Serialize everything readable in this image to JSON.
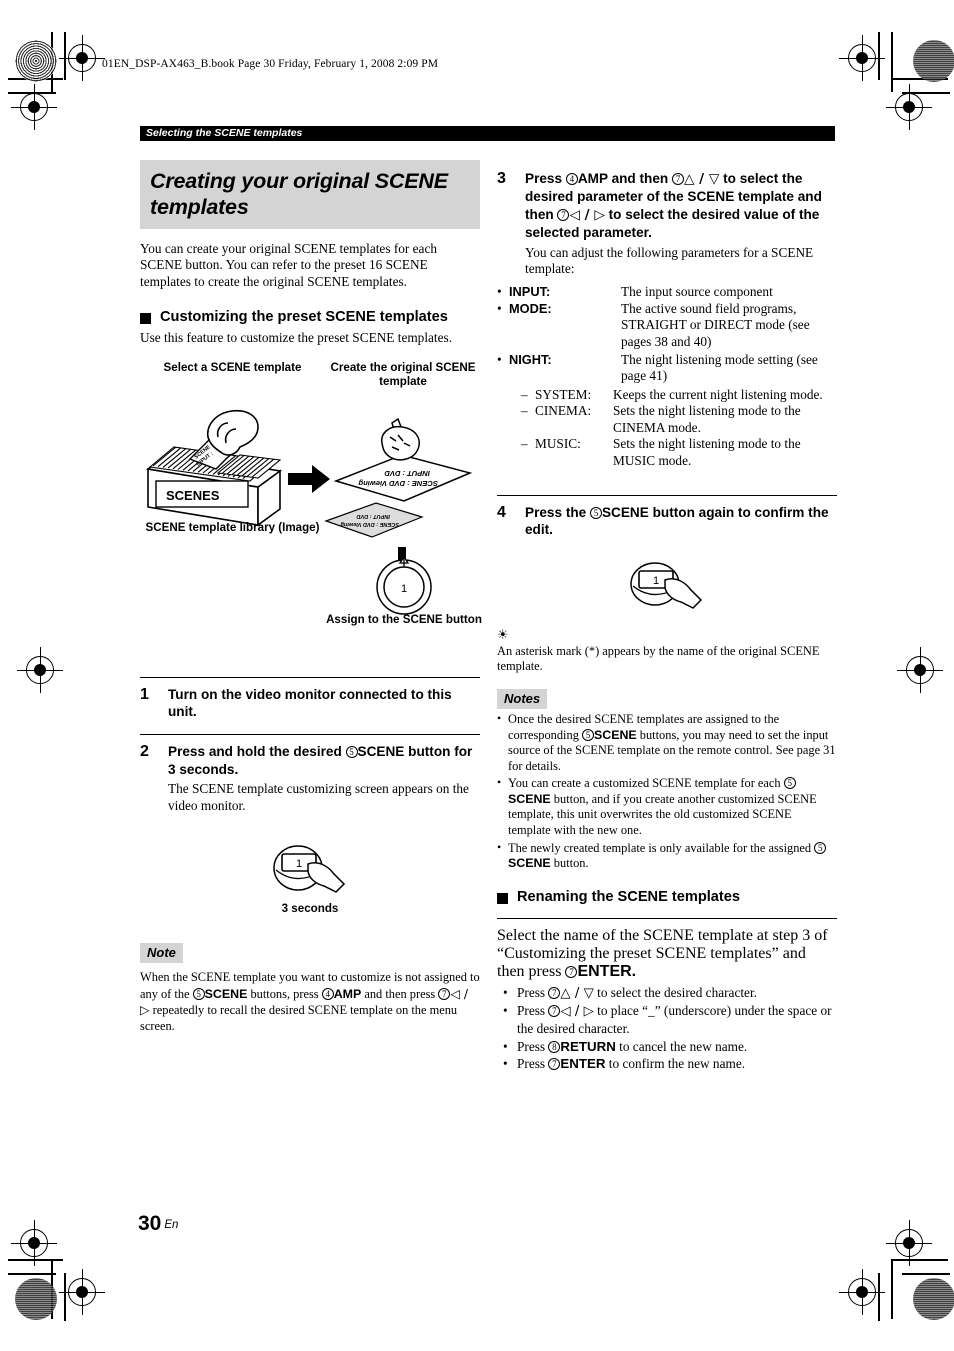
{
  "page": {
    "file_header": "01EN_DSP-AX463_B.book  Page 30  Friday, February 1, 2008  2:09 PM",
    "running_head": "Selecting the SCENE templates",
    "page_number": "30",
    "page_lang": "En"
  },
  "left": {
    "section_title": "Creating your original SCENE templates",
    "intro": "You can create your original SCENE templates for each SCENE button. You can refer to the preset 16 SCENE templates to create the original SCENE templates.",
    "subhead": "Customizing the preset SCENE templates",
    "subhead_body": "Use this feature to customize the preset SCENE templates.",
    "figure": {
      "label_select": "Select a SCENE template",
      "label_create": "Create the original SCENE template",
      "label_library": "SCENE template library (Image)",
      "label_assign": "Assign to the SCENE button",
      "box_label": "SCENES",
      "card_line1": "SCENE : DVD Viewing",
      "card_line2": "INPUT : DVD",
      "button_digit": "1"
    },
    "steps": [
      {
        "num": "1",
        "title_parts": [
          {
            "t": "Turn on the video monitor connected to this unit.",
            "k": "plain"
          }
        ],
        "body": ""
      },
      {
        "num": "2",
        "title_parts": [
          {
            "t": "Press and hold the desired ",
            "k": "plain"
          },
          {
            "t": "5",
            "k": "circ"
          },
          {
            "t": "SCENE",
            "k": "strong"
          },
          {
            "t": " button for 3 seconds.",
            "k": "plain"
          }
        ],
        "body": "The SCENE template customizing screen appears on the video monitor."
      }
    ],
    "seconds_label": "3 seconds",
    "note_label": "Note",
    "note_parts": [
      {
        "t": "When the SCENE template you want to customize is not assigned to any of the ",
        "k": "plain"
      },
      {
        "t": "5",
        "k": "circ"
      },
      {
        "t": "SCENE",
        "k": "strong"
      },
      {
        "t": " buttons, press ",
        "k": "plain"
      },
      {
        "t": "4",
        "k": "circ"
      },
      {
        "t": "AMP",
        "k": "strong"
      },
      {
        "t": " and then press ",
        "k": "plain"
      },
      {
        "t": "7",
        "k": "circ"
      },
      {
        "t": "◁ / ▷",
        "k": "glyph"
      },
      {
        "t": " repeatedly to recall the desired SCENE template on the menu screen.",
        "k": "plain"
      }
    ]
  },
  "right": {
    "step3": {
      "num": "3",
      "title_parts": [
        {
          "t": "Press ",
          "k": "plain"
        },
        {
          "t": "4",
          "k": "circ"
        },
        {
          "t": "AMP",
          "k": "strong"
        },
        {
          "t": " and then ",
          "k": "plain"
        },
        {
          "t": "7",
          "k": "circ"
        },
        {
          "t": "△ / ▽",
          "k": "glyph"
        },
        {
          "t": " to select the desired parameter of the SCENE template and then ",
          "k": "plain"
        },
        {
          "t": "7",
          "k": "circ"
        },
        {
          "t": "◁ / ▷",
          "k": "glyph"
        },
        {
          "t": " to select the desired value of the selected parameter.",
          "k": "plain"
        }
      ],
      "body": "You can adjust the following parameters for a SCENE template:"
    },
    "parameters": [
      {
        "term": "INPUT",
        "desc": "The input source component"
      },
      {
        "term": "MODE",
        "desc": "The active sound field programs, STRAIGHT or DIRECT mode (see pages 38 and 40)"
      },
      {
        "term": "NIGHT",
        "desc": "The night listening mode setting (see page 41)"
      }
    ],
    "night_subitems": [
      {
        "term": "SYSTEM:",
        "desc": "Keeps the current night listening mode."
      },
      {
        "term": "CINEMA:",
        "desc": "Sets the night listening mode to the CINEMA mode."
      },
      {
        "term": "MUSIC:",
        "desc": "Sets the night listening mode to the MUSIC mode."
      }
    ],
    "step4": {
      "num": "4",
      "title_parts": [
        {
          "t": "Press the ",
          "k": "plain"
        },
        {
          "t": "5",
          "k": "circ"
        },
        {
          "t": "SCENE",
          "k": "strong"
        },
        {
          "t": " button again to confirm the edit.",
          "k": "plain"
        }
      ],
      "button_digit": "1"
    },
    "tip_text": "An asterisk mark (*) appears by the name of the original SCENE template.",
    "notes_label": "Notes",
    "notes": [
      [
        {
          "t": "Once the desired SCENE templates are assigned to the corresponding ",
          "k": "plain"
        },
        {
          "t": "5",
          "k": "circ"
        },
        {
          "t": "SCENE",
          "k": "strong"
        },
        {
          "t": " buttons, you may need to set the input source of the SCENE template on the remote control. See page 31 for details.",
          "k": "plain"
        }
      ],
      [
        {
          "t": "You can create a customized SCENE template for each ",
          "k": "plain"
        },
        {
          "t": "5",
          "k": "circ"
        },
        {
          "t": "SCENE",
          "k": "strong"
        },
        {
          "t": " button, and if you create another customized SCENE template, this unit overwrites the old customized SCENE template with the new one.",
          "k": "plain"
        }
      ],
      [
        {
          "t": "The newly created template is only available for the assigned ",
          "k": "plain"
        },
        {
          "t": "5",
          "k": "circ"
        },
        {
          "t": "SCENE",
          "k": "strong"
        },
        {
          "t": " button.",
          "k": "plain"
        }
      ]
    ],
    "rename_subhead": "Renaming the SCENE templates",
    "rename_intro_parts": [
      {
        "t": "Select the name of the SCENE template at step 3 of “Customizing the preset SCENE templates” and then press ",
        "k": "plain"
      },
      {
        "t": "7",
        "k": "circ"
      },
      {
        "t": "ENTER.",
        "k": "strong"
      }
    ],
    "rename_bullets": [
      [
        {
          "t": "Press ",
          "k": "plain"
        },
        {
          "t": "7",
          "k": "circ"
        },
        {
          "t": "△ / ▽",
          "k": "glyph"
        },
        {
          "t": " to select the desired character.",
          "k": "plain"
        }
      ],
      [
        {
          "t": "Press ",
          "k": "plain"
        },
        {
          "t": "7",
          "k": "circ"
        },
        {
          "t": "◁ / ▷",
          "k": "glyph"
        },
        {
          "t": " to place “_” (underscore) under the space or the desired character.",
          "k": "plain"
        }
      ],
      [
        {
          "t": "Press ",
          "k": "plain"
        },
        {
          "t": "8",
          "k": "circ"
        },
        {
          "t": "RETURN",
          "k": "strong"
        },
        {
          "t": " to cancel the new name.",
          "k": "plain"
        }
      ],
      [
        {
          "t": "Press ",
          "k": "plain"
        },
        {
          "t": "7",
          "k": "circ"
        },
        {
          "t": "ENTER",
          "k": "strong"
        },
        {
          "t": " to confirm the new name.",
          "k": "plain"
        }
      ]
    ]
  },
  "colors": {
    "band": "#d4d4d4",
    "runhead_bg": "#000000",
    "text": "#000000"
  }
}
